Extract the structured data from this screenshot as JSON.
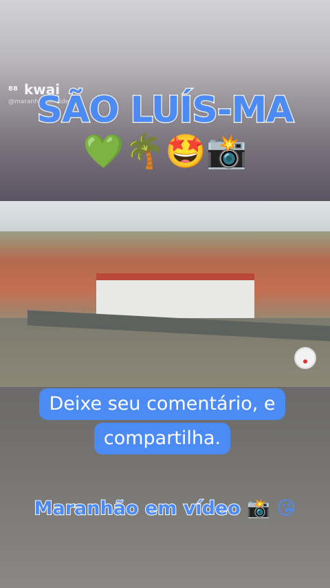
{
  "overlay": {
    "app_logo": "kwai",
    "handle": "@maranhaoemvideo"
  },
  "header": {
    "title": "SÃO LUÍS-MA",
    "emojis": "💚🌴🤩📸"
  },
  "caption": {
    "line1": "Deixe seu comentário, e",
    "line2": "compartilha."
  },
  "footer": {
    "text": "Maranhão em vídeo",
    "emojis": "📸 😘"
  },
  "colors": {
    "accent": "#4d8bf4",
    "text": "#ffffff"
  }
}
